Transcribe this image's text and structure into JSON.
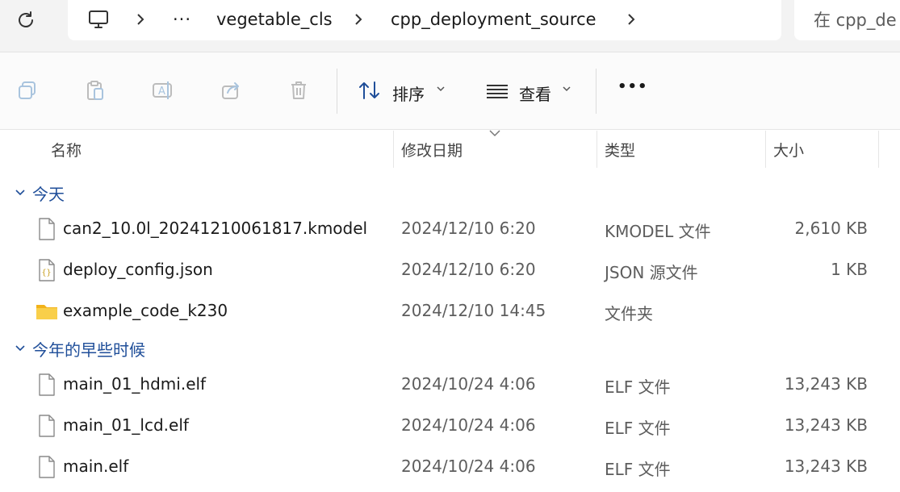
{
  "breadcrumb": {
    "overflow": "···",
    "items": [
      "vegetable_cls",
      "cpp_deployment_source"
    ]
  },
  "search": {
    "placeholder": "在 cpp_de"
  },
  "toolbar": {
    "sort_label": "排序",
    "view_label": "查看",
    "more_label": "•••"
  },
  "columns": {
    "name": "名称",
    "date": "修改日期",
    "type": "类型",
    "size": "大小"
  },
  "groups": [
    {
      "label": "今天",
      "rows": [
        {
          "icon": "file-icon",
          "name": "can2_10.0l_20241210061817.kmodel",
          "date": "2024/12/10 6:20",
          "type": "KMODEL 文件",
          "size": "2,610 KB"
        },
        {
          "icon": "json-file-icon",
          "name": "deploy_config.json",
          "date": "2024/12/10 6:20",
          "type": "JSON 源文件",
          "size": "1 KB"
        },
        {
          "icon": "folder-icon",
          "name": "example_code_k230",
          "date": "2024/12/10 14:45",
          "type": "文件夹",
          "size": ""
        }
      ]
    },
    {
      "label": "今年的早些时候",
      "rows": [
        {
          "icon": "file-icon",
          "name": "main_01_hdmi.elf",
          "date": "2024/10/24 4:06",
          "type": "ELF 文件",
          "size": "13,243 KB"
        },
        {
          "icon": "file-icon",
          "name": "main_01_lcd.elf",
          "date": "2024/10/24 4:06",
          "type": "ELF 文件",
          "size": "13,243 KB"
        },
        {
          "icon": "file-icon",
          "name": "main.elf",
          "date": "2024/10/24 4:06",
          "type": "ELF 文件",
          "size": "13,243 KB"
        }
      ]
    }
  ],
  "colors": {
    "group_header": "#1f4e99",
    "folder": "#f7c948",
    "icon_gray": "#9aa5b1"
  }
}
